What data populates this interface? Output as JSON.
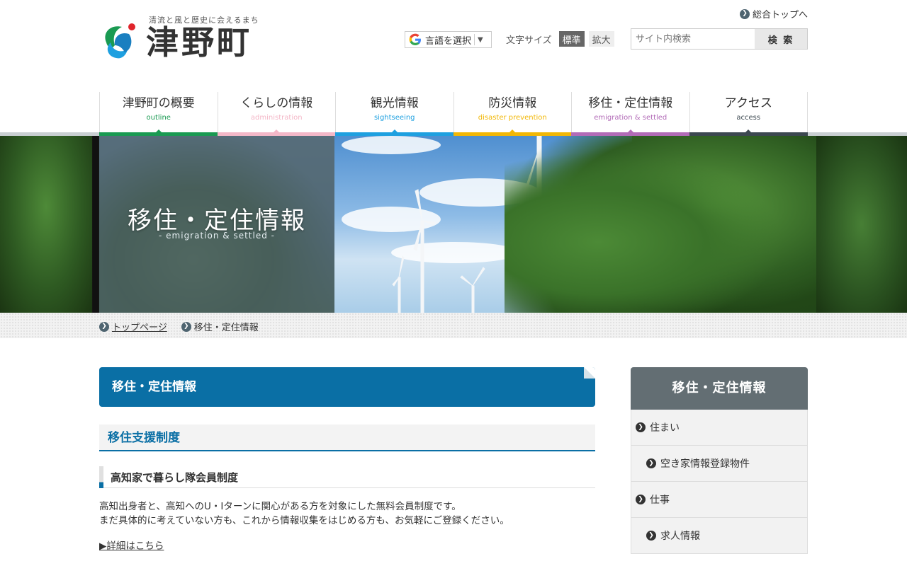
{
  "header": {
    "tagline": "清流と風と歴史に会えるまち",
    "town_name": "津野町",
    "top_link": "総合トップへ",
    "translate_label": "言語を選択",
    "fontsize_label": "文字サイズ",
    "fontsize_standard": "標準",
    "fontsize_large": "拡大",
    "search_placeholder": "サイト内検索",
    "search_button": "検 索"
  },
  "nav": [
    {
      "jp": "津野町の概要",
      "en": "outline",
      "color": "#1a9a52"
    },
    {
      "jp": "くらしの情報",
      "en": "administration",
      "color": "#f4b8c8"
    },
    {
      "jp": "観光情報",
      "en": "sightseeing",
      "color": "#1ea0e0"
    },
    {
      "jp": "防災情報",
      "en": "disaster prevention",
      "color": "#f2b705"
    },
    {
      "jp": "移住・定住情報",
      "en": "emigration & settled",
      "color": "#b26bb7"
    },
    {
      "jp": "アクセス",
      "en": "access",
      "color": "#3c4850"
    }
  ],
  "hero": {
    "title": "移住・定住情報",
    "subtitle": "- emigration & settled -"
  },
  "breadcrumb": {
    "home": "トップページ",
    "current": "移住・定住情報"
  },
  "main": {
    "page_title": "移住・定住情報",
    "section_title": "移住支援制度",
    "subsection_title": "高知家で暮らし隊会員制度",
    "body_line1": "高知出身者と、高知へのU・Iターンに関心がある方を対象にした無料会員制度です。",
    "body_line2": "まだ具体的に考えていない方も、これから情報収集をはじめる方も、お気軽にご登録ください。",
    "detail_link": "▶詳細はこちら"
  },
  "sidebar": {
    "title": "移住・定住情報",
    "items": [
      {
        "label": "住まい",
        "level": 1
      },
      {
        "label": "空き家情報登録物件",
        "level": 2
      },
      {
        "label": "仕事",
        "level": 1
      },
      {
        "label": "求人情報",
        "level": 2
      }
    ]
  },
  "colors": {
    "primary_blue": "#0a6fa5",
    "sidebar_head": "#636e73"
  }
}
